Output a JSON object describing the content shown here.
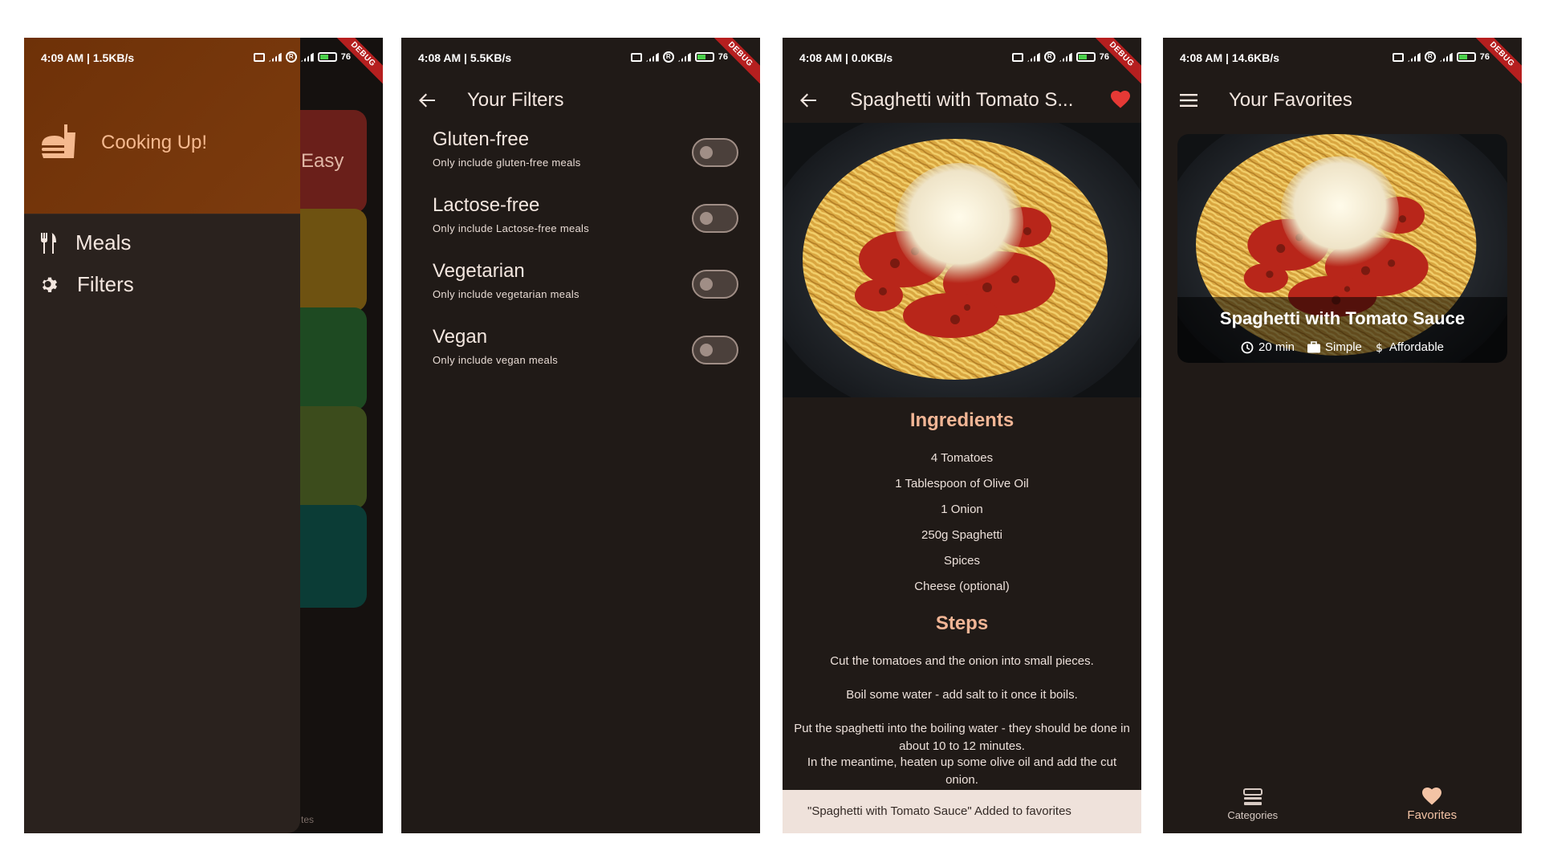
{
  "colors": {
    "background": "#201a17",
    "drawer_header": "#7c3b0e",
    "accent": "#f1b595",
    "heart": "#e53935",
    "debug_banner": "#b51f1f",
    "snackbar": "#efe2db"
  },
  "debug_label": "DEBUG",
  "panel1": {
    "status": "4:09 AM | 1.5KB/s",
    "battery": "76",
    "drawer_title": "Cooking Up!",
    "drawer_icon": "fastfood-icon",
    "items": [
      {
        "label": "Meals",
        "icon": "restaurant-icon"
      },
      {
        "label": "Filters",
        "icon": "gear-icon"
      }
    ],
    "background_card_text": "Easy",
    "background_tab_text": "tes"
  },
  "panel2": {
    "status": "4:08 AM | 5.5KB/s",
    "battery": "76",
    "title": "Your Filters",
    "filters": [
      {
        "title": "Gluten-free",
        "subtitle": "Only include gluten-free meals",
        "on": false
      },
      {
        "title": "Lactose-free",
        "subtitle": "Only include Lactose-free meals",
        "on": false
      },
      {
        "title": "Vegetarian",
        "subtitle": "Only include vegetarian meals",
        "on": false
      },
      {
        "title": "Vegan",
        "subtitle": "Only include vegan meals",
        "on": false
      }
    ]
  },
  "panel3": {
    "status": "4:08 AM | 0.0KB/s",
    "battery": "76",
    "title": "Spaghetti with Tomato S...",
    "ingredients_title": "Ingredients",
    "ingredients": [
      "4 Tomatoes",
      "1 Tablespoon of Olive Oil",
      "1 Onion",
      "250g Spaghetti",
      "Spices",
      "Cheese (optional)"
    ],
    "steps_title": "Steps",
    "steps": [
      "Cut the tomatoes and the onion into small pieces.",
      "Boil some water - add salt to it once it boils.",
      "Put the spaghetti into the boiling water - they should be done in about 10 to 12 minutes.",
      "In the meantime, heaten up some olive oil and add the cut onion."
    ],
    "snackbar": "\"Spaghetti with Tomato Sauce\" Added to favorites"
  },
  "panel4": {
    "status": "4:08 AM | 14.6KB/s",
    "battery": "76",
    "title": "Your Favorites",
    "meal": {
      "title": "Spaghetti with Tomato Sauce",
      "duration": "20 min",
      "complexity": "Simple",
      "affordability": "Affordable"
    },
    "nav": [
      {
        "label": "Categories",
        "icon": "categories-icon",
        "active": false
      },
      {
        "label": "Favorites",
        "icon": "heart-icon",
        "active": true
      }
    ]
  }
}
